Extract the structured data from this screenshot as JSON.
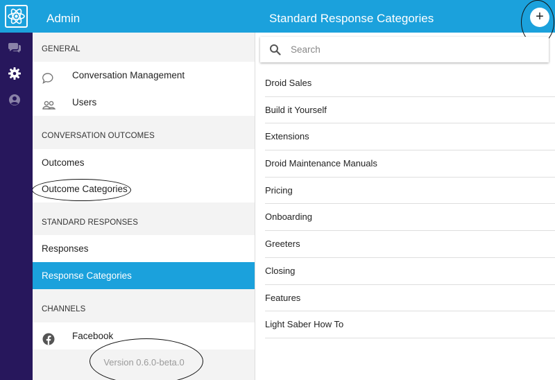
{
  "app": {
    "section_title": "Admin",
    "page_title": "Standard Response Categories",
    "add_label": "+"
  },
  "rail": {
    "icons": [
      "atom-logo-icon",
      "chat-bubble-icon",
      "gear-icon",
      "account-icon"
    ]
  },
  "sidebar": {
    "sections": [
      {
        "heading": "GENERAL",
        "items": [
          {
            "label": "Conversation Management",
            "icon": "chat-bubble-outline-icon"
          },
          {
            "label": "Users",
            "icon": "people-icon"
          }
        ]
      },
      {
        "heading": "CONVERSATION OUTCOMES",
        "items": [
          {
            "label": "Outcomes"
          },
          {
            "label": "Outcome Categories"
          }
        ]
      },
      {
        "heading": "STANDARD RESPONSES",
        "items": [
          {
            "label": "Responses"
          },
          {
            "label": "Response Categories",
            "active": true
          }
        ]
      },
      {
        "heading": "CHANNELS",
        "items": [
          {
            "label": "Facebook",
            "icon": "facebook-icon"
          }
        ]
      }
    ],
    "version": "Version 0.6.0-beta.0"
  },
  "search": {
    "placeholder": "Search",
    "value": ""
  },
  "categories": [
    "Droid Sales",
    "Build it Yourself",
    "Extensions",
    "Droid Maintenance Manuals",
    "Pricing",
    "Onboarding",
    "Greeters",
    "Closing",
    "Features",
    "Light Saber How To"
  ],
  "colors": {
    "header": "#1ba1dc",
    "rail": "#27175c",
    "active": "#1ba1dc",
    "panel": "#f3f3f3"
  }
}
